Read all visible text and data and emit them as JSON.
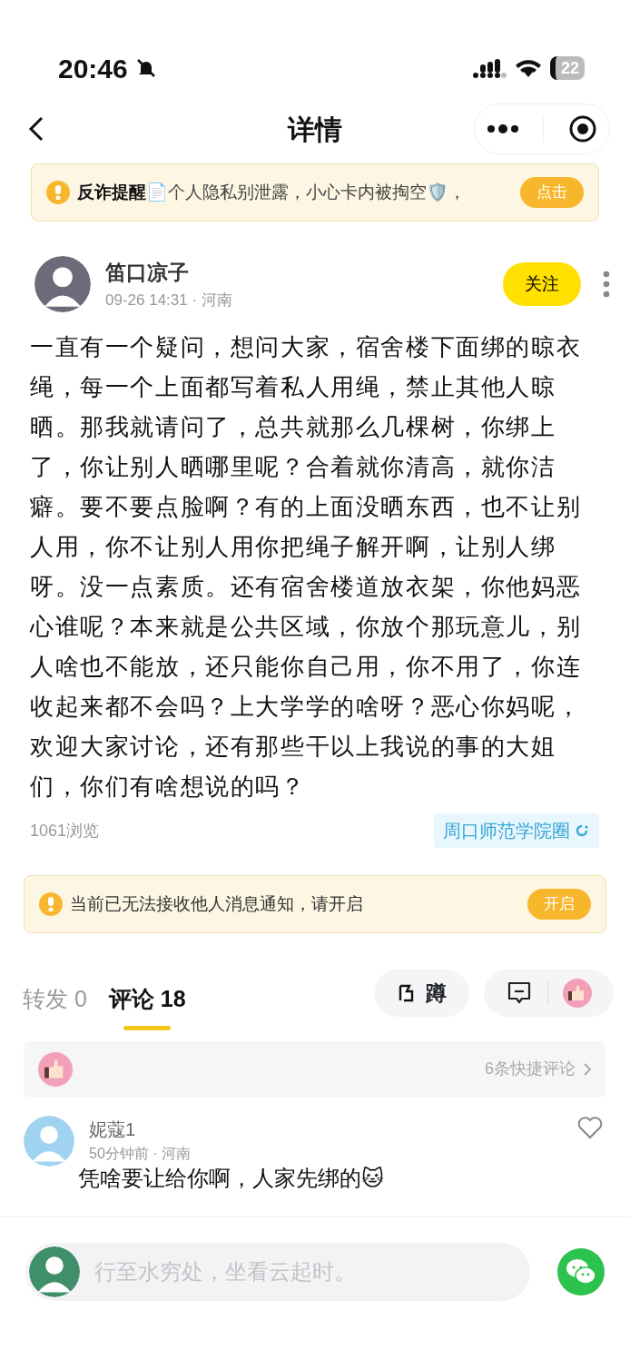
{
  "status_bar": {
    "time": "20:46",
    "battery": "22"
  },
  "nav": {
    "title": "详情"
  },
  "fraud_banner": {
    "title": "反诈提醒",
    "text": "📄个人隐私别泄露，小心卡内被掏空🛡️，",
    "button": "点击"
  },
  "post": {
    "author": "笛口凉子",
    "meta": "09-26 14:31 · 河南",
    "follow_button": "关注",
    "body": "一直有一个疑问，想问大家，宿舍楼下面绑的晾衣绳，每一个上面都写着私人用绳，禁止其他人晾晒。那我就请问了，总共就那么几棵树，你绑上了，你让别人晒哪里呢？合着就你清高，就你洁癖。要不要点脸啊？有的上面没晒东西，也不让别人用，你不让别人用你把绳子解开啊，让别人绑呀。没一点素质。还有宿舍楼道放衣架，你他妈恶心谁呢？本来就是公共区域，你放个那玩意儿，别人啥也不能放，还只能你自己用，你不用了，你连收起来都不会吗？上大学学的啥呀？恶心你妈呢，欢迎大家讨论，还有那些干以上我说的事的大姐们，你们有啥想说的吗？",
    "views": "1061浏览",
    "circle": "周口师范学院圈"
  },
  "notice": {
    "text": "当前已无法接收他人消息通知，请开启",
    "button": "开启"
  },
  "tabs": [
    {
      "label": "转发",
      "count": "0",
      "selected": false
    },
    {
      "label": "评论",
      "count": "18",
      "selected": true
    }
  ],
  "squat_button": "蹲",
  "quick_comments": {
    "text": "6条快捷评论"
  },
  "comments": [
    {
      "author": "妮蔻1",
      "meta": "50分钟前 · 河南",
      "text": "凭啥要让给你啊，人家先绑的🐱",
      "liked": false
    }
  ],
  "input": {
    "placeholder": "行至水穷处，坐看云起时。"
  }
}
